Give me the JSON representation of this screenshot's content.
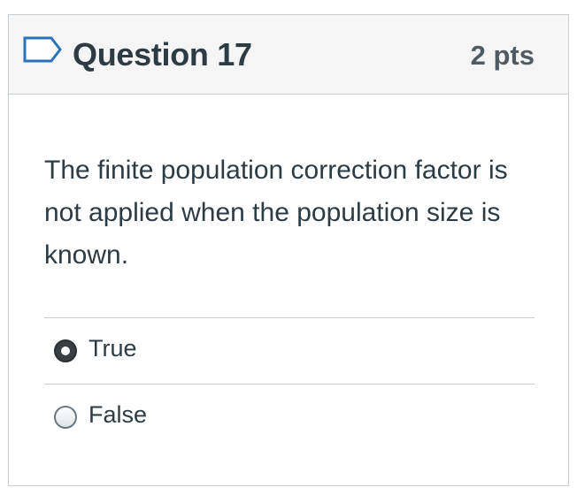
{
  "question": {
    "title": "Question 17",
    "points": "2 pts",
    "flag_icon": "bookmark-flag-icon",
    "text": "The finite population correction factor is not applied when the population size is known."
  },
  "answers": [
    {
      "label": "True",
      "selected": true
    },
    {
      "label": "False",
      "selected": false
    }
  ],
  "colors": {
    "text": "#2d3b45",
    "header_bg": "#f5f5f5",
    "border": "#c7cdd1",
    "flag_stroke": "#2b73b8"
  }
}
